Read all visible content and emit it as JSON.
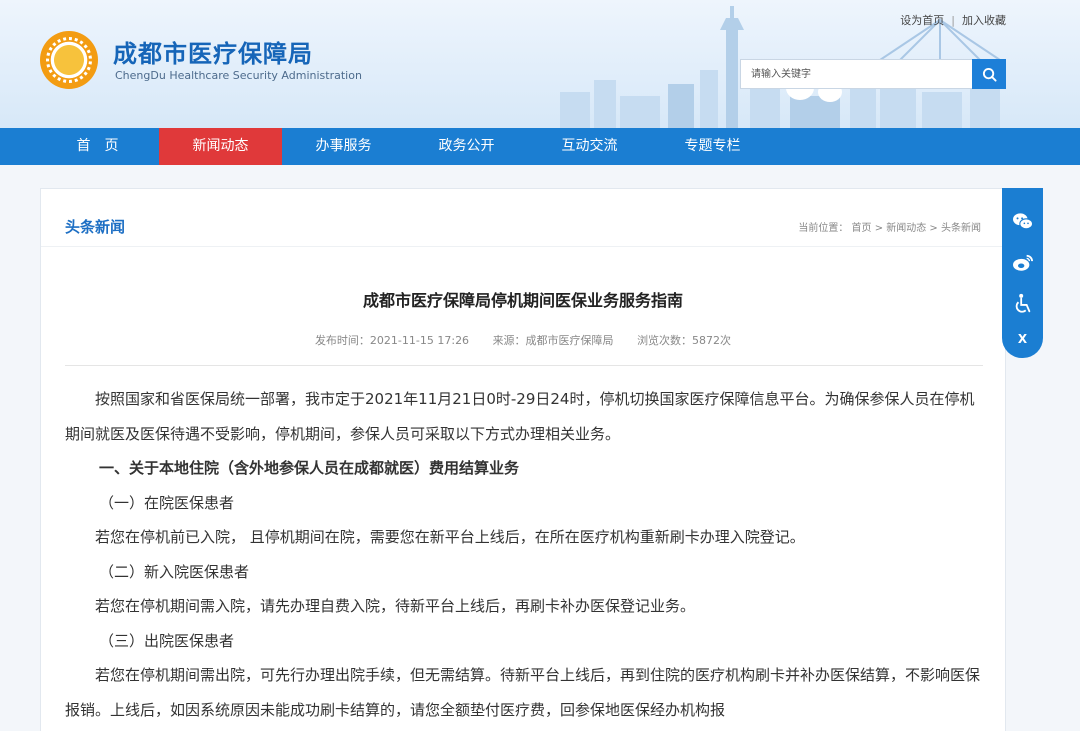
{
  "site": {
    "title": "成都市医疗保障局",
    "subtitle": "ChengDu Healthcare Security Administration"
  },
  "top_links": [
    "设为首页",
    "加入收藏"
  ],
  "search": {
    "placeholder": "请输入关键字"
  },
  "nav": [
    "首　页",
    "新闻动态",
    "办事服务",
    "政务公开",
    "互动交流",
    "专题专栏"
  ],
  "section": {
    "title": "头条新闻",
    "breadcrumb": "当前位置： 首页 > 新闻动态 > 头条新闻"
  },
  "article": {
    "title": "成都市医疗保障局停机期间医保业务服务指南",
    "publish": "发布时间：2021-11-15 17:26",
    "source": "来源：成都市医疗保障局",
    "views": "浏览次数：5872次",
    "paragraphs": [
      "按照国家和省医保局统一部署，我市定于2021年11月21日0时-29日24时，停机切换国家医疗保障信息平台。为确保参保人员在停机期间就医及医保待遇不受影响，停机期间，参保人员可采取以下方式办理相关业务。",
      "一、关于本地住院（含外地参保人员在成都就医）费用结算业务",
      "（一）在院医保患者",
      "若您在停机前已入院， 且停机期间在院，需要您在新平台上线后，在所在医疗机构重新刷卡办理入院登记。",
      "（二）新入院医保患者",
      "若您在停机期间需入院，请先办理自费入院，待新平台上线后，再刷卡补办医保登记业务。",
      "（三）出院医保患者",
      "若您在停机期间需出院，可先行办理出院手续，但无需结算。待新平台上线后，再到住院的医疗机构刷卡并补办医保结算，不影响医保报销。上线后，如因系统原因未能成功刷卡结算的，请您全额垫付医疗费，回参保地医保经办机构报"
    ]
  },
  "sidebar": {
    "close_label": "X"
  },
  "colors": {
    "brand": "#1b7ed2",
    "active_nav": "#e0393a",
    "title": "#1665b8"
  }
}
